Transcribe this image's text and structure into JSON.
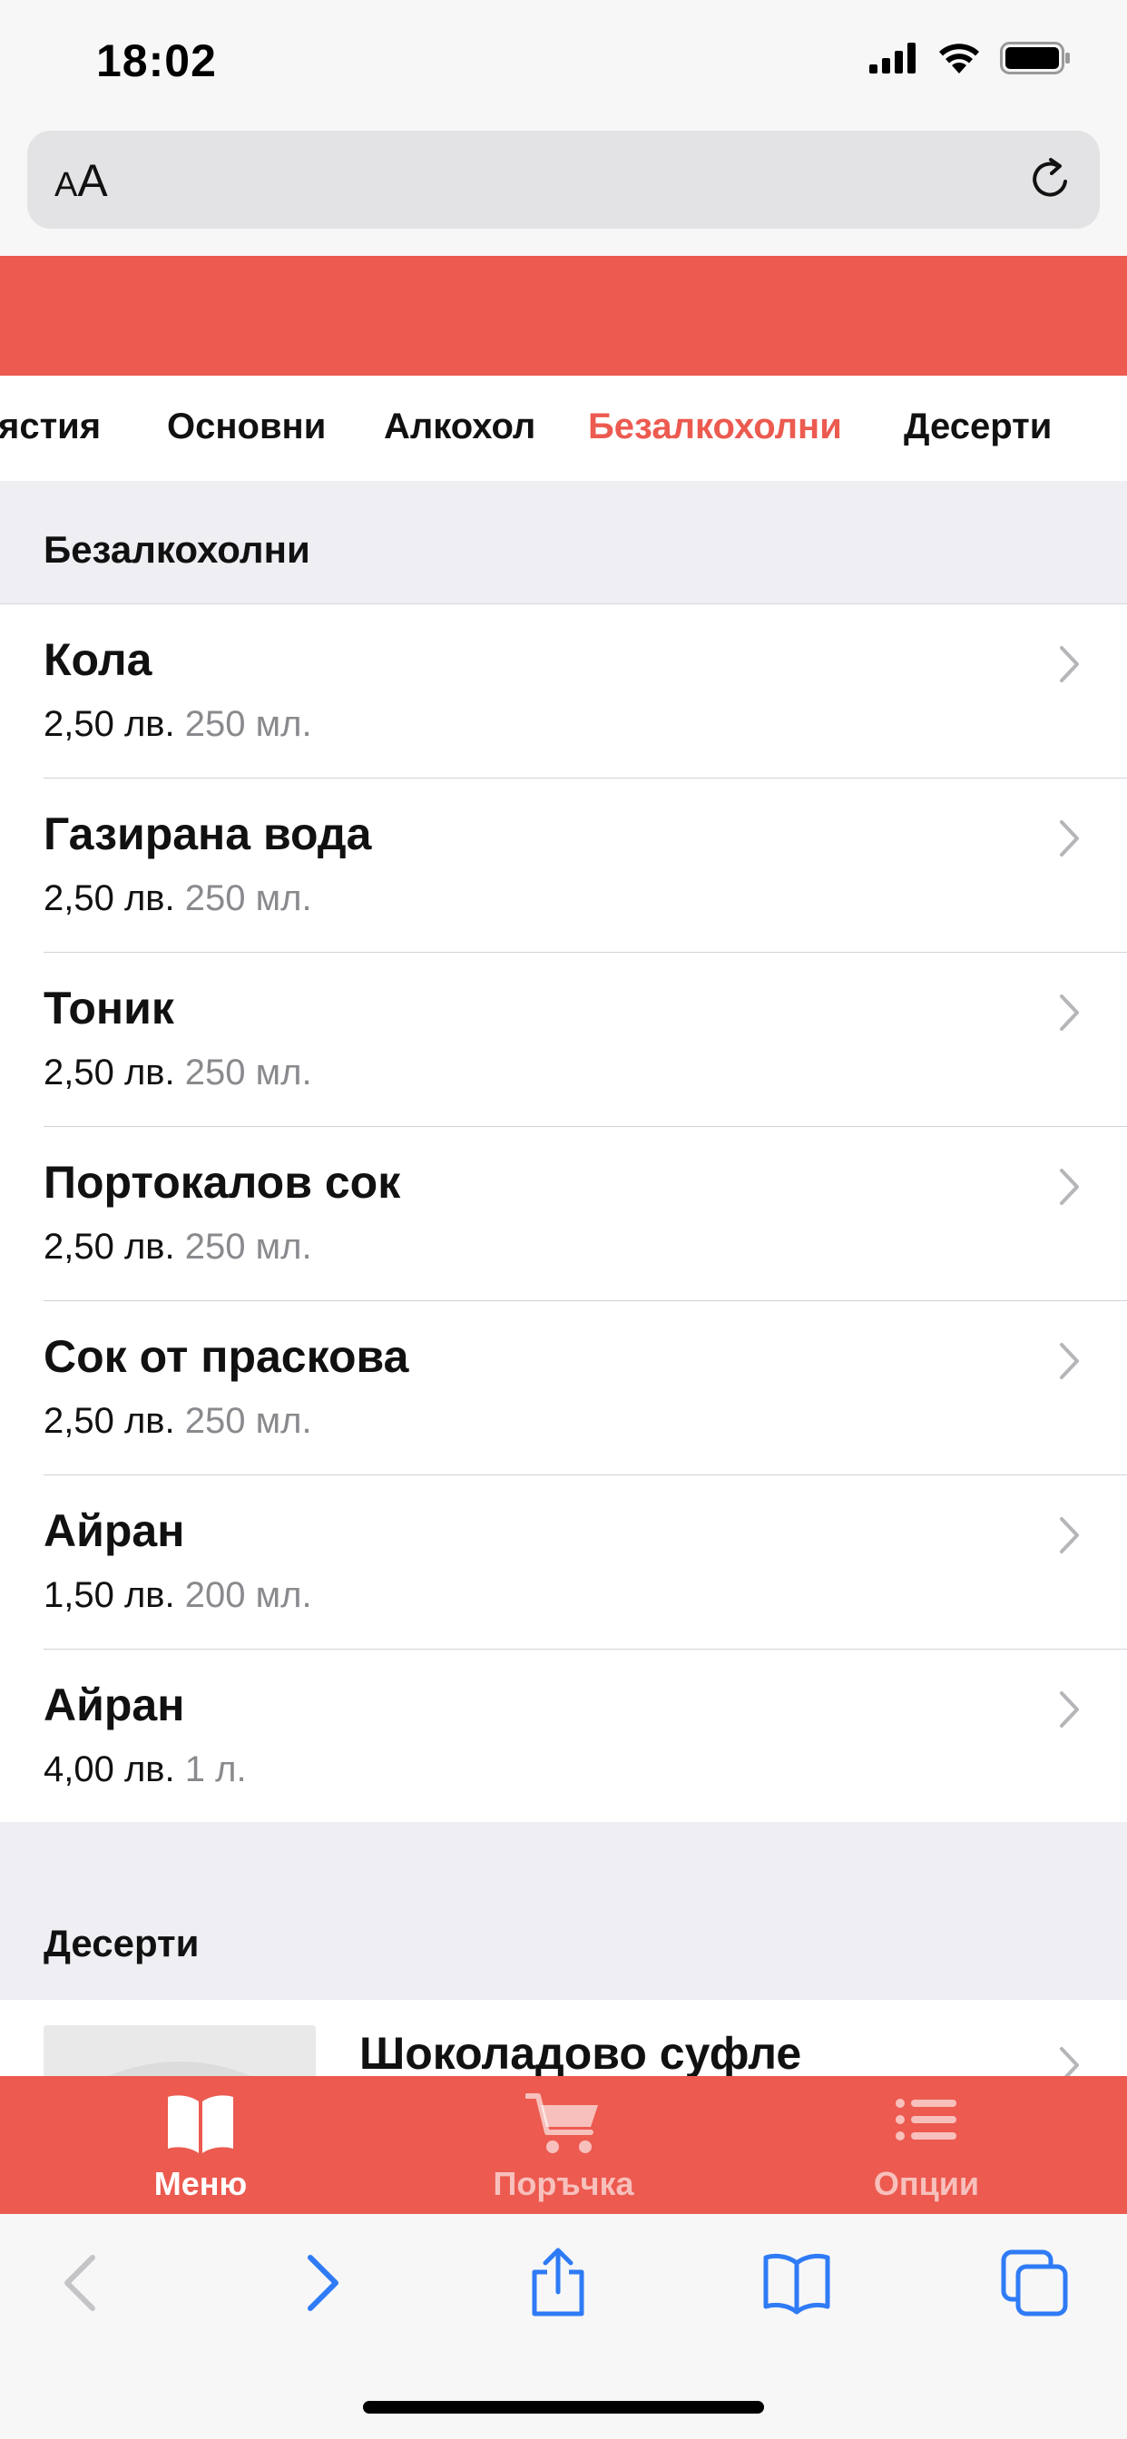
{
  "status_bar": {
    "time": "18:02"
  },
  "browser": {
    "text_size_small": "A",
    "text_size_large": "A"
  },
  "tabs": [
    {
      "label": "ястия"
    },
    {
      "label": "Основни"
    },
    {
      "label": "Алкохол"
    },
    {
      "label": "Безалкохолни"
    },
    {
      "label": "Десерти"
    }
  ],
  "sections": {
    "drinks_title": "Безалкохолни",
    "desserts_title": "Десерти"
  },
  "items": [
    {
      "name": "Кола",
      "price": "2,50 лв.",
      "volume": "250 мл."
    },
    {
      "name": "Газирана вода",
      "price": "2,50 лв.",
      "volume": "250 мл."
    },
    {
      "name": "Тоник",
      "price": "2,50 лв.",
      "volume": "250 мл."
    },
    {
      "name": "Портокалов сок",
      "price": "2,50 лв.",
      "volume": "250 мл."
    },
    {
      "name": "Сок от праскова",
      "price": "2,50 лв.",
      "volume": "250 мл."
    },
    {
      "name": "Айран",
      "price": "1,50 лв.",
      "volume": "200 мл."
    },
    {
      "name": "Айран",
      "price": "4,00 лв.",
      "volume": "1 л."
    }
  ],
  "dessert_item": {
    "name": "Шоколадово суфле"
  },
  "bottom_nav": {
    "menu": "Меню",
    "order": "Поръчка",
    "options": "Опции"
  },
  "colors": {
    "brand_red": "#ec5a50",
    "safari_blue": "#2f7bf6",
    "muted_text": "#8a8a8e"
  },
  "icons": {
    "menu": "book-icon",
    "order": "cart-icon",
    "options": "list-icon"
  }
}
